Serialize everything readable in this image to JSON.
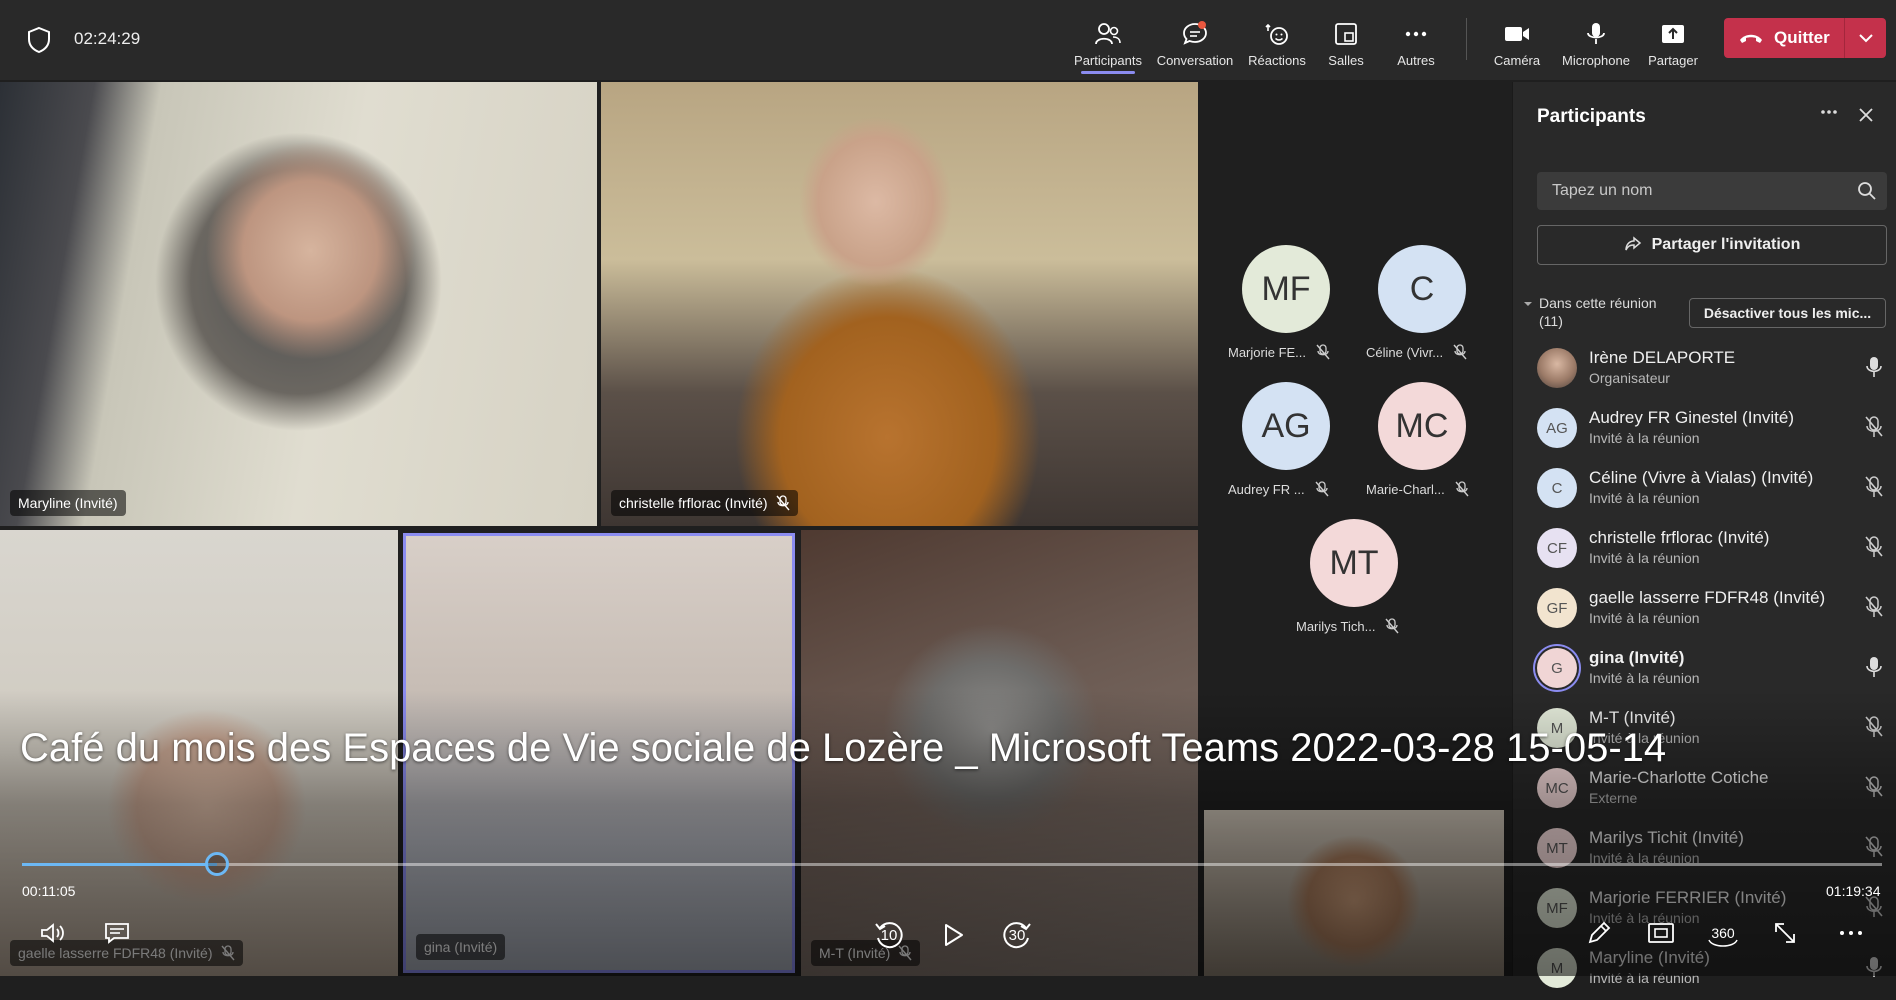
{
  "topbar": {
    "timer": "02:24:29",
    "items": [
      {
        "label": "Participants",
        "icon": "participants-icon"
      },
      {
        "label": "Conversation",
        "icon": "chat-icon"
      },
      {
        "label": "Réactions",
        "icon": "reactions-icon"
      },
      {
        "label": "Salles",
        "icon": "rooms-icon"
      },
      {
        "label": "Autres",
        "icon": "more-icon"
      },
      {
        "label": "Caméra",
        "icon": "camera-icon"
      },
      {
        "label": "Microphone",
        "icon": "microphone-icon"
      },
      {
        "label": "Partager",
        "icon": "share-icon"
      }
    ],
    "quit_label": "Quitter",
    "accent": "#8b8cf0",
    "quit_color": "#c4314b"
  },
  "videos": [
    {
      "label": "Maryline (Invité)",
      "muted": false
    },
    {
      "label": "christelle frflorac (Invité)",
      "muted": true
    },
    {
      "label": "gaelle lasserre FDFR48 (Invité)",
      "muted": true
    },
    {
      "label": "gina (Invité)",
      "muted": false
    },
    {
      "label": "M-T (Invité)",
      "muted": true
    }
  ],
  "avatars": [
    {
      "initials": "MF",
      "label": "Marjorie FE...",
      "color": "#e3ead9"
    },
    {
      "initials": "C",
      "label": "Céline (Vivr...",
      "color": "#d4e2f3"
    },
    {
      "initials": "AG",
      "label": "Audrey FR ...",
      "color": "#d4e2f3"
    },
    {
      "initials": "MC",
      "label": "Marie-Charl...",
      "color": "#f3d9d9"
    },
    {
      "initials": "MT",
      "label": "Marilys Tich...",
      "color": "#f3d9d9"
    }
  ],
  "panel": {
    "title": "Participants",
    "search_placeholder": "Tapez un nom",
    "share_invite": "Partager l'invitation",
    "section_label": "Dans cette réunion",
    "section_count": "(11)",
    "mute_all": "Désactiver tous les mic...",
    "participants": [
      {
        "initials": "",
        "name": "Irène DELAPORTE",
        "role": "Organisateur",
        "muted": false,
        "photo": true,
        "color": "#b49a8a"
      },
      {
        "initials": "AG",
        "name": "Audrey FR Ginestel (Invité)",
        "role": "Invité à la réunion",
        "muted": true,
        "color": "#d4e2f3"
      },
      {
        "initials": "C",
        "name": "Céline (Vivre à Vialas) (Invité)",
        "role": "Invité à la réunion",
        "muted": true,
        "color": "#d4e2f3"
      },
      {
        "initials": "CF",
        "name": "christelle frflorac (Invité)",
        "role": "Invité à la réunion",
        "muted": true,
        "color": "#e7e1f2"
      },
      {
        "initials": "GF",
        "name": "gaelle lasserre FDFR48 (Invité)",
        "role": "Invité à la réunion",
        "muted": true,
        "color": "#f2e4cf"
      },
      {
        "initials": "G",
        "name": "gina (Invité)",
        "role": "Invité à la réunion",
        "muted": false,
        "color": "#f0d5d5",
        "speaking": true
      },
      {
        "initials": "M",
        "name": "M-T (Invité)",
        "role": "Invité à la réunion",
        "muted": true,
        "color": "#e3ead9"
      },
      {
        "initials": "MC",
        "name": "Marie-Charlotte Cotiche",
        "role": "Externe",
        "muted": true,
        "color": "#f3d9d9"
      },
      {
        "initials": "MT",
        "name": "Marilys Tichit (Invité)",
        "role": "Invité à la réunion",
        "muted": true,
        "color": "#f3d9d9"
      },
      {
        "initials": "MF",
        "name": "Marjorie FERRIER (Invité)",
        "role": "Invité à la réunion",
        "muted": true,
        "color": "#e3ead9"
      },
      {
        "initials": "M",
        "name": "Maryline (Invité)",
        "role": "Invité à la réunion",
        "muted": false,
        "color": "#e3ead9"
      }
    ]
  },
  "player": {
    "title": "Café du mois des Espaces de Vie sociale de Lozère _ Microsoft Teams 2022-03-28 15-05-14",
    "current_time": "00:11:05",
    "duration": "01:19:34",
    "progress_fraction": 0.105,
    "rewind_label": "10",
    "forward_label": "30",
    "vr_label": "360",
    "progress_color": "#6cb8f5"
  }
}
